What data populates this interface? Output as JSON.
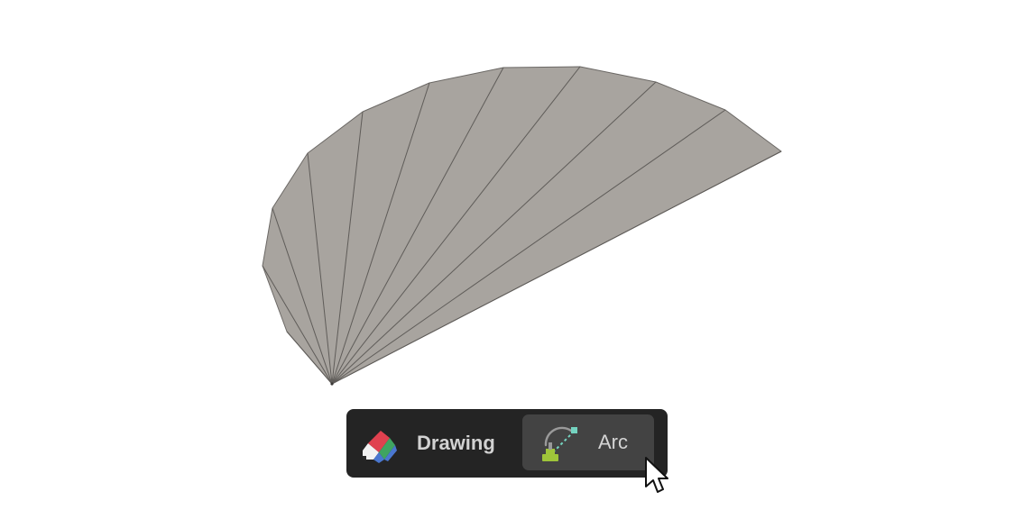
{
  "toolbar": {
    "category_label": "Drawing",
    "category_icon": "drawing-pencil-icon",
    "tool_label": "Arc",
    "tool_icon": "arc-tool-icon"
  },
  "viewport": {
    "object": "fan-arc-surface",
    "face_color": "#a8a49f",
    "edge_color": "#5f5c59"
  },
  "colors": {
    "toolbar_bg": "#242424",
    "button_bg": "#434343",
    "text": "#d2d2d2"
  }
}
